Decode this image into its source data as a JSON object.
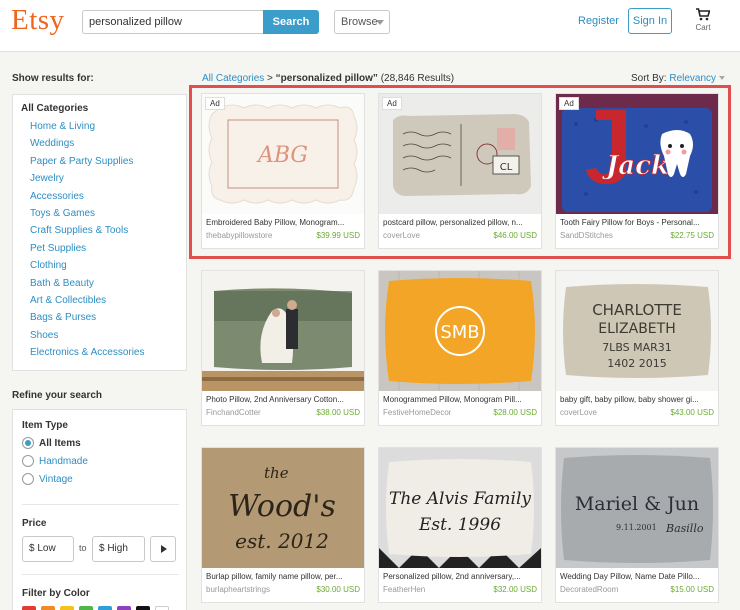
{
  "header": {
    "logo": "Etsy",
    "search_value": "personalized pillow",
    "search_button": "Search",
    "browse_label": "Browse",
    "register_label": "Register",
    "signin_label": "Sign In",
    "cart_label": "Cart"
  },
  "sidebar": {
    "show_results_title": "Show results for:",
    "all_categories": "All Categories",
    "categories": [
      "Home & Living",
      "Weddings",
      "Paper & Party Supplies",
      "Jewelry",
      "Accessories",
      "Toys & Games",
      "Craft Supplies & Tools",
      "Pet Supplies",
      "Clothing",
      "Bath & Beauty",
      "Art & Collectibles",
      "Bags & Purses",
      "Shoes",
      "Electronics & Accessories"
    ],
    "refine_title": "Refine your search",
    "item_type_label": "Item Type",
    "item_types": [
      "All Items",
      "Handmade",
      "Vintage"
    ],
    "price_label": "Price",
    "price_low": "$ Low",
    "price_to": "to",
    "price_high": "$ High",
    "filter_color_label": "Filter by Color",
    "color_swatches": [
      "#e03c31",
      "#f08a24",
      "#f5c21b",
      "#4db848",
      "#2e9fd9",
      "#8e3fbf",
      "#111111",
      "#ffffff"
    ]
  },
  "results": {
    "breadcrumb_link": "All Categories",
    "breadcrumb_sep": " > ",
    "query_label": "“personalized pillow”",
    "count_label": "(28,846 Results)",
    "sort_label": "Sort By:",
    "sort_value": "Relevancy",
    "ad_label": "Ad",
    "listings": [
      {
        "title": "Embroidered Baby Pillow, Monogram...",
        "shop": "thebabypillowstore",
        "price": "$39.99 USD",
        "art_text": "ABG"
      },
      {
        "title": "postcard pillow, personalized pillow, n...",
        "shop": "coverLove",
        "price": "$46.00 USD",
        "art_text": "CL"
      },
      {
        "title": "Tooth Fairy Pillow for Boys - Personal...",
        "shop": "SandDStitches",
        "price": "$22.75 USD",
        "art_text": "Jack"
      },
      {
        "title": "Photo Pillow, 2nd Anniversary Cotton...",
        "shop": "FinchandCotter",
        "price": "$38.00 USD",
        "art_text": ""
      },
      {
        "title": "Monogrammed Pillow, Monogram Pill...",
        "shop": "FestiveHomeDecor",
        "price": "$28.00 USD",
        "art_text": "SMB"
      },
      {
        "title": "baby gift, baby pillow, baby shower gi...",
        "shop": "coverLove",
        "price": "$43.00 USD",
        "art_text": "CHARLOTTE ELIZABETH"
      },
      {
        "title": "Burlap pillow, family name pillow, per...",
        "shop": "burlapheartstrings",
        "price": "$30.00 USD",
        "art_text": "the Wood's est. 2012"
      },
      {
        "title": "Personalized pillow, 2nd anniversary,...",
        "shop": "FeatherHen",
        "price": "$32.00 USD",
        "art_text": "The Alvis Family Est. 1996"
      },
      {
        "title": "Wedding Day Pillow, Name Date Pillo...",
        "shop": "DecoratedRoom",
        "price": "$15.00 USD",
        "art_text": "Mariel & Jun"
      }
    ]
  }
}
